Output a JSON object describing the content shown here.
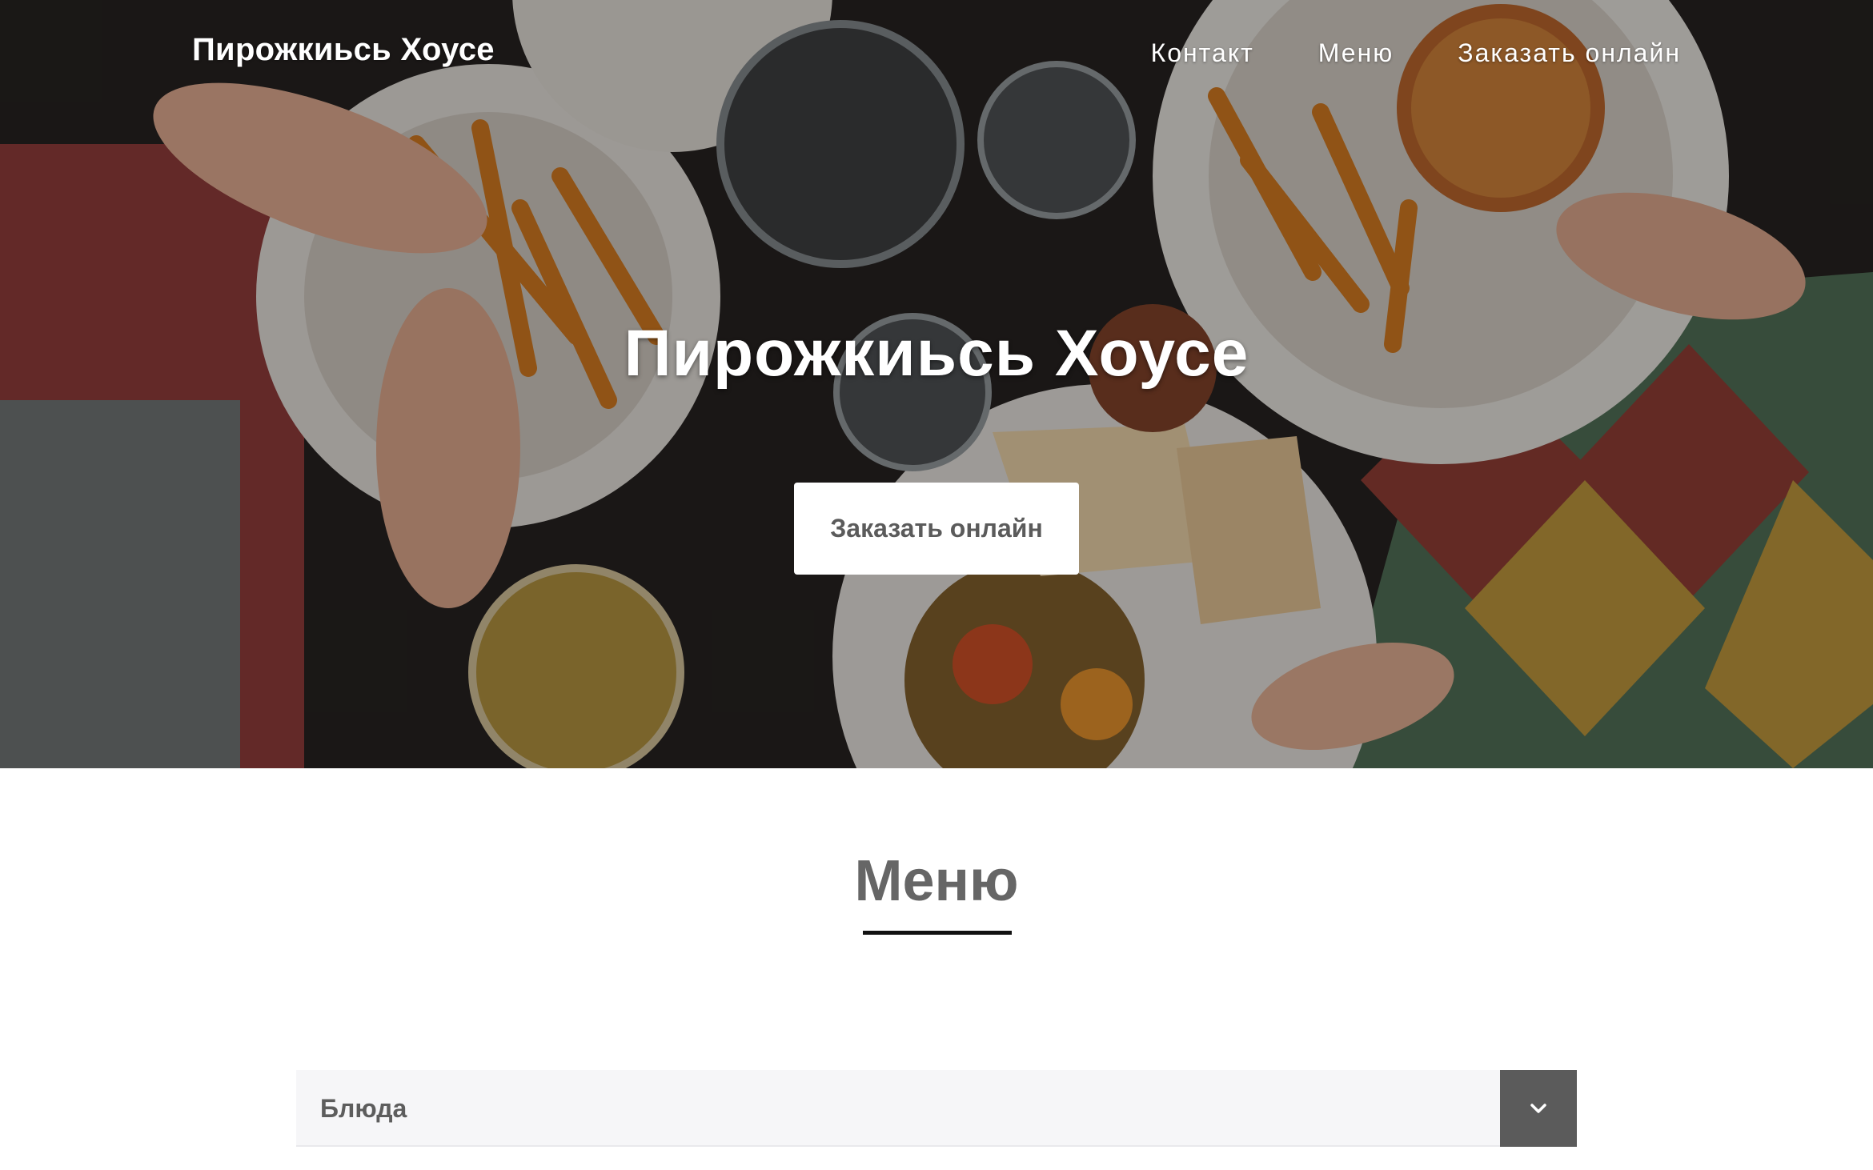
{
  "header": {
    "brand": "Пирожкиьсь Хоусе",
    "nav": [
      {
        "label": "Контакт"
      },
      {
        "label": "Меню"
      },
      {
        "label": "Заказать онлайн"
      }
    ]
  },
  "hero": {
    "title": "Пирожкиьсь Хоусе",
    "cta_label": "Заказать онлайн"
  },
  "menu": {
    "heading": "Меню",
    "categories": [
      {
        "label": "Блюда",
        "toggle_icon": "chevron-down-icon"
      }
    ]
  },
  "colors": {
    "button_bg": "#ffffff",
    "heading_text": "#666666",
    "accordion_bg": "#f6f6f8",
    "accordion_toggle_bg": "#5b5b5b"
  }
}
